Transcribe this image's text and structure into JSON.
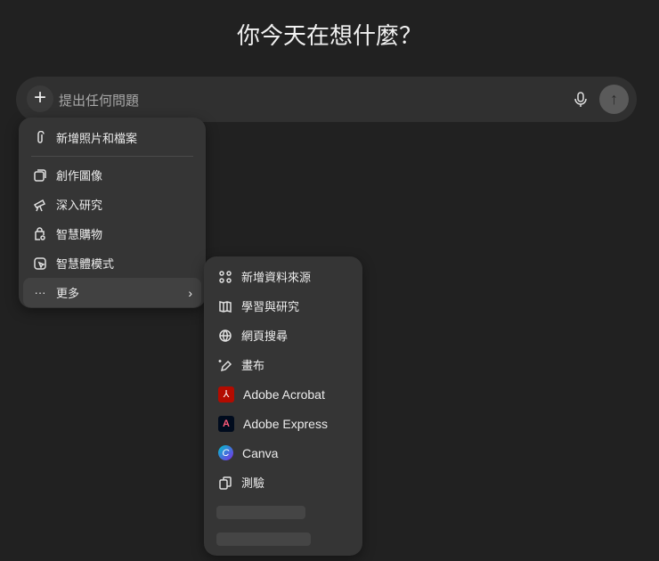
{
  "heading": "你今天在想什麼？",
  "composer": {
    "placeholder": "提出任何問題"
  },
  "menu": {
    "attach": "新增照片和檔案",
    "items": [
      "創作圖像",
      "深入研究",
      "智慧購物",
      "智慧體模式"
    ],
    "more": "更多"
  },
  "submenu": {
    "items": [
      "新增資料來源",
      "學習與研究",
      "網頁搜尋",
      "畫布",
      "Adobe Acrobat",
      "Adobe Express",
      "Canva",
      "測驗"
    ]
  },
  "colors": {
    "background": "#212121",
    "composer": "#303030",
    "menu": "#353535",
    "acrobat": "#b30b00",
    "canva": "#7d2ae8"
  }
}
